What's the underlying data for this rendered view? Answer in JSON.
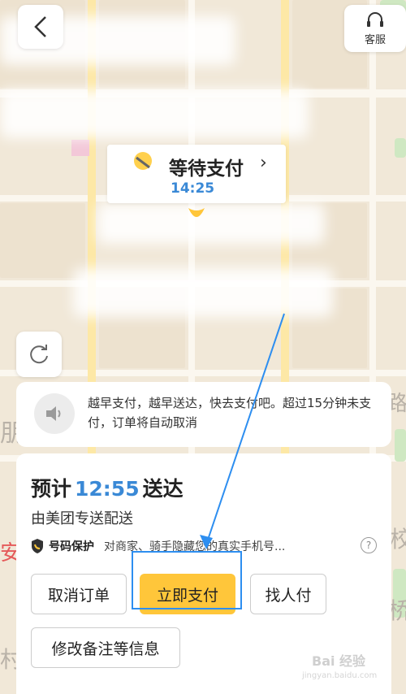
{
  "header": {
    "service_label": "客服"
  },
  "status_card": {
    "title": "等待支付",
    "time": "14:25"
  },
  "map_labels": [
    "朋",
    "安",
    "路",
    "校",
    "桥",
    "村"
  ],
  "notice": {
    "message": "越早支付，越早送达，快去支付吧。超过15分钟未支付，订单将自动取消"
  },
  "panel": {
    "eta_prefix": "预计",
    "eta_time": "12:55",
    "eta_suffix": "送达",
    "delivery_by": "由美团专送配送",
    "privacy_tag": "号码保护",
    "privacy_desc": "对商家、骑手隐藏您的真实手机号...",
    "buttons": {
      "cancel": "取消订单",
      "pay": "立即支付",
      "find": "找人付",
      "edit": "修改备注等信息"
    }
  },
  "watermark": {
    "brand": "Bai 经验",
    "url": "jingyan.baidu.com"
  },
  "colors": {
    "accent_blue": "#3a89d6",
    "pay_yellow": "#ffc63a",
    "highlight_blue": "#2d8ef0"
  }
}
